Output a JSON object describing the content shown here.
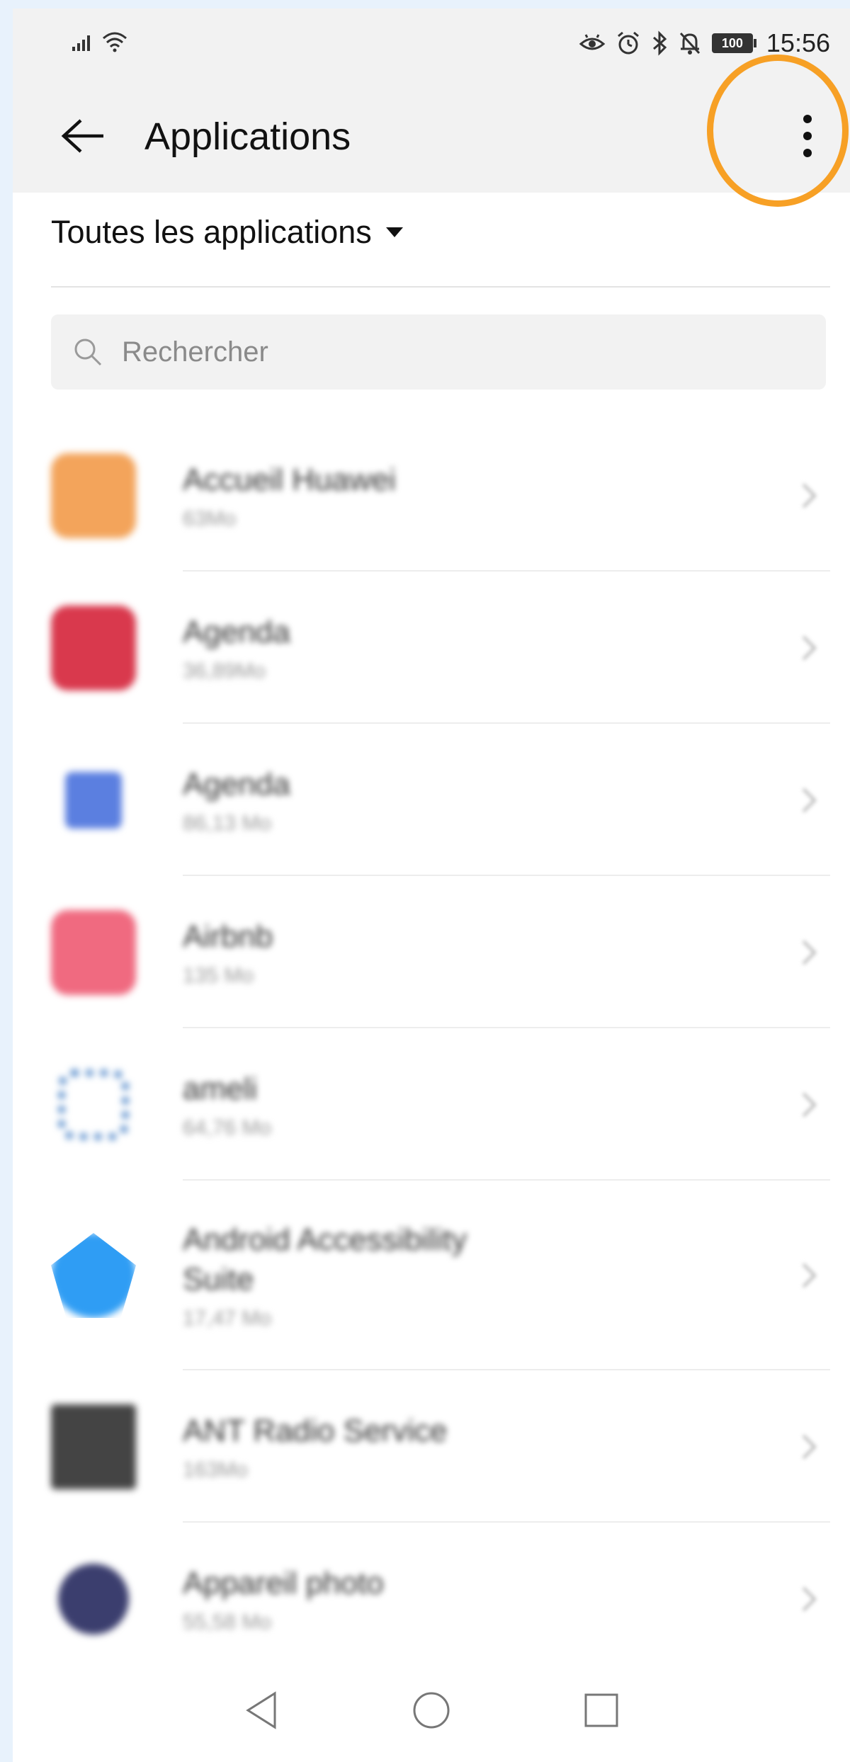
{
  "status_bar": {
    "time": "15:56",
    "battery": "100"
  },
  "header": {
    "title": "Applications"
  },
  "filter": {
    "label": "Toutes les applications"
  },
  "search": {
    "placeholder": "Rechercher"
  },
  "apps": [
    {
      "name": "Accueil Huawei",
      "size": "63Mo",
      "icon_color": "#f3a45b"
    },
    {
      "name": "Agenda",
      "size": "36,89Mo",
      "icon_color": "#d9394d"
    },
    {
      "name": "Agenda",
      "size": "86,13 Mo",
      "icon_color": "#5b7fe0"
    },
    {
      "name": "Airbnb",
      "size": "135 Mo",
      "icon_color": "#f06a80"
    },
    {
      "name": "ameli",
      "size": "64,76 Mo",
      "icon_color": "#3a78c2"
    },
    {
      "name": "Android Accessibility Suite",
      "size": "17,47 Mo",
      "icon_color": "#2f9df4"
    },
    {
      "name": "ANT Radio Service",
      "size": "163Mo",
      "icon_color": "#444444"
    },
    {
      "name": "Appareil photo",
      "size": "55,58 Mo",
      "icon_color": "#3b3e6e"
    }
  ],
  "colors": {
    "highlight": "#f7a025",
    "bar_background": "#f2f2f2"
  }
}
